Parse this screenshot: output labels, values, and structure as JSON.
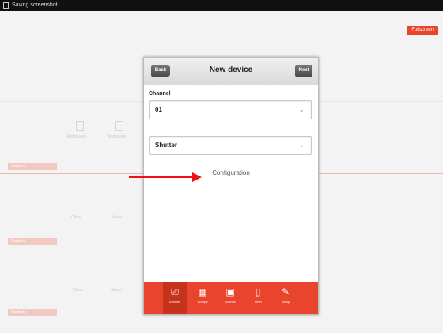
{
  "status_bar": {
    "text": "Saving screenshot..."
  },
  "top_button": {
    "label": "Fullscreen"
  },
  "background": {
    "rows": [
      {
        "tab": "Shutters"
      },
      {
        "tab": "Shutters"
      },
      {
        "tab": "Shutters"
      }
    ],
    "faint_labels": [
      "Add device",
      "Add scene",
      "Close",
      "Select",
      "Close",
      "Select"
    ]
  },
  "modal": {
    "back_label": "Back",
    "title": "New device",
    "next_label": "Next",
    "channel_label": "Channel",
    "channel_value": "01",
    "type_value": "Shutter",
    "configuration_link": "Configuration"
  },
  "bottom_nav": [
    {
      "label": "Devices",
      "icon": "device-icon",
      "glyph": "⎚"
    },
    {
      "label": "Groups",
      "icon": "groups-icon",
      "glyph": "▦"
    },
    {
      "label": "Scenes",
      "icon": "scenes-icon",
      "glyph": "▣"
    },
    {
      "label": "Timer",
      "icon": "timer-icon",
      "glyph": "▯"
    },
    {
      "label": "Setup",
      "icon": "setup-icon",
      "glyph": "✎"
    }
  ],
  "colors": {
    "accent": "#e8452c",
    "annotation_arrow": "#ee1111"
  }
}
